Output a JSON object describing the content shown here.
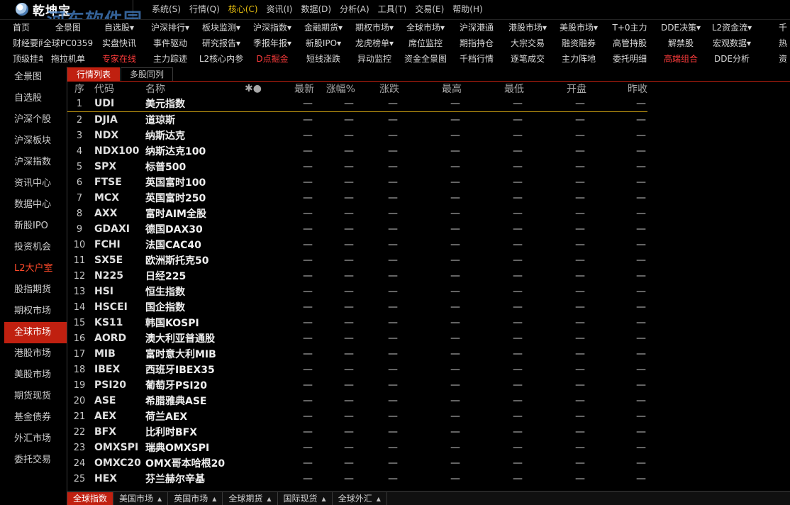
{
  "app": {
    "title": "乾坤宝",
    "watermark": "河东软件园",
    "watermark_url": "www.pc0359.cn"
  },
  "menus": [
    {
      "label": "系统(S)",
      "name": "system"
    },
    {
      "label": "行情(Q)",
      "name": "quote"
    },
    {
      "label": "核心(C)",
      "name": "core",
      "active": true
    },
    {
      "label": "资讯(I)",
      "name": "news"
    },
    {
      "label": "数据(D)",
      "name": "data"
    },
    {
      "label": "分析(A)",
      "name": "analysis"
    },
    {
      "label": "工具(T)",
      "name": "tools"
    },
    {
      "label": "交易(E)",
      "name": "trade"
    },
    {
      "label": "帮助(H)",
      "name": "help"
    }
  ],
  "function_grid": {
    "rows": [
      [
        "首页",
        "全景图",
        "自选股▾",
        "沪深排行▾",
        "板块监测▾",
        "沪深指数▾",
        "金融期货▾",
        "期权市场▾",
        "全球市场▾",
        "沪深港通",
        "港股市场▾",
        "美股市场▾",
        "T+0主力",
        "DDE决策▾",
        "L2资金流▾",
        "千"
      ],
      [
        "财经要闻",
        "全球PC0359",
        "实盘快讯",
        "事件驱动",
        "研究报告▾",
        "季报年报▾",
        "新股IPO▾",
        "龙虎榜单▾",
        "席位监控",
        "期指持仓",
        "大宗交易",
        "融资融券",
        "高管持股",
        "解禁股",
        "宏观数据▾",
        "热"
      ],
      [
        "顶级挂单",
        "拖拉机单",
        "专家在线",
        "主力踪迹",
        "L2核心内参",
        "D点掘金",
        "短线涨跌",
        "异动监控",
        "资金全景图",
        "千档行情",
        "逐笔成交",
        "主力阵地",
        "委托明细",
        "高端组合",
        "DDE分析",
        "资"
      ]
    ],
    "red_cells": [
      "专家在线",
      "D点掘金",
      "高端组合"
    ]
  },
  "sidebar": {
    "items": [
      {
        "label": "全景图"
      },
      {
        "label": "自选股"
      },
      {
        "label": "沪深个股"
      },
      {
        "label": "沪深板块"
      },
      {
        "label": "沪深指数"
      },
      {
        "label": "资讯中心"
      },
      {
        "label": "数据中心"
      },
      {
        "label": "新股IPO"
      },
      {
        "label": "投资机会"
      },
      {
        "label": "L2大户室",
        "red": true
      },
      {
        "label": "股指期货"
      },
      {
        "label": "期权市场"
      },
      {
        "label": "全球市场",
        "active": true
      },
      {
        "label": "港股市场"
      },
      {
        "label": "美股市场"
      },
      {
        "label": "期货现货"
      },
      {
        "label": "基金债券"
      },
      {
        "label": "外汇市场"
      },
      {
        "label": "委托交易"
      }
    ]
  },
  "tabs": [
    {
      "label": "行情列表",
      "active": true
    },
    {
      "label": "多股同列",
      "active": false
    }
  ],
  "table": {
    "headers": {
      "idx": "序",
      "code": "代码",
      "name": "名称",
      "star": "✱●",
      "latest": "最新",
      "change_pct": "涨幅%",
      "change": "涨跌",
      "high": "最高",
      "low": "最低",
      "open": "开盘",
      "prev_close": "昨收"
    },
    "placeholder": "—",
    "rows": [
      {
        "idx": "1",
        "code": "UDI",
        "name": "美元指数"
      },
      {
        "idx": "2",
        "code": "DJIA",
        "name": "道琼斯"
      },
      {
        "idx": "3",
        "code": "NDX",
        "name": "纳斯达克"
      },
      {
        "idx": "4",
        "code": "NDX100",
        "name": "纳斯达克100"
      },
      {
        "idx": "5",
        "code": "SPX",
        "name": "标普500"
      },
      {
        "idx": "6",
        "code": "FTSE",
        "name": "英国富时100"
      },
      {
        "idx": "7",
        "code": "MCX",
        "name": "英国富时250"
      },
      {
        "idx": "8",
        "code": "AXX",
        "name": "富时AIM全股"
      },
      {
        "idx": "9",
        "code": "GDAXI",
        "name": "德国DAX30"
      },
      {
        "idx": "10",
        "code": "FCHI",
        "name": "法国CAC40"
      },
      {
        "idx": "11",
        "code": "SX5E",
        "name": "欧洲斯托克50"
      },
      {
        "idx": "12",
        "code": "N225",
        "name": "日经225"
      },
      {
        "idx": "13",
        "code": "HSI",
        "name": "恒生指数"
      },
      {
        "idx": "14",
        "code": "HSCEI",
        "name": "国企指数"
      },
      {
        "idx": "15",
        "code": "KS11",
        "name": "韩国KOSPI"
      },
      {
        "idx": "16",
        "code": "AORD",
        "name": "澳大利亚普通股"
      },
      {
        "idx": "17",
        "code": "MIB",
        "name": "富时意大利MIB"
      },
      {
        "idx": "18",
        "code": "IBEX",
        "name": "西班牙IBEX35"
      },
      {
        "idx": "19",
        "code": "PSI20",
        "name": "葡萄牙PSI20"
      },
      {
        "idx": "20",
        "code": "ASE",
        "name": "希腊雅典ASE"
      },
      {
        "idx": "21",
        "code": "AEX",
        "name": "荷兰AEX"
      },
      {
        "idx": "22",
        "code": "BFX",
        "name": "比利时BFX"
      },
      {
        "idx": "23",
        "code": "OMXSPI",
        "name": "瑞典OMXSPI"
      },
      {
        "idx": "24",
        "code": "OMXC20",
        "name": "OMX哥本哈根20"
      },
      {
        "idx": "25",
        "code": "HEX",
        "name": "芬兰赫尔辛基"
      }
    ]
  },
  "bottom_tabs": [
    {
      "label": "全球指数",
      "active": true,
      "caret": false
    },
    {
      "label": "美国市场",
      "active": false,
      "caret": true
    },
    {
      "label": "英国市场",
      "active": false,
      "caret": true
    },
    {
      "label": "全球期货",
      "active": false,
      "caret": true
    },
    {
      "label": "国际现货",
      "active": false,
      "caret": true
    },
    {
      "label": "全球外汇",
      "active": false,
      "caret": true
    }
  ],
  "colors": {
    "accent_red": "#c02010",
    "menu_active": "#e8c010",
    "text_red": "#ff3c3c"
  }
}
